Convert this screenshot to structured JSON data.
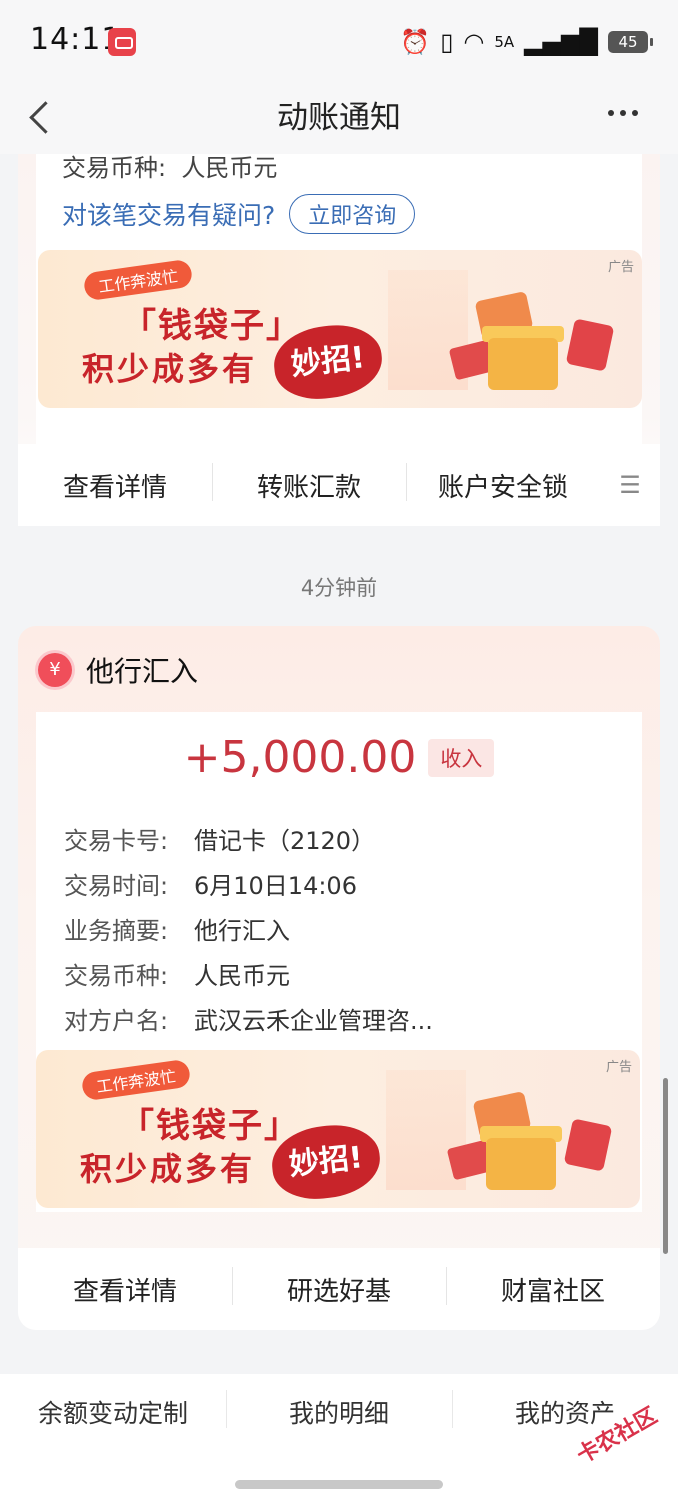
{
  "status_bar": {
    "time": "14:11",
    "network": "5A",
    "battery": "45"
  },
  "header": {
    "title": "动账通知"
  },
  "card1": {
    "cut_row": {
      "key": "交易币种:",
      "value": "人民币元"
    },
    "query_text": "对该笔交易有疑问?",
    "consult_label": "立即咨询",
    "banner": {
      "tag": "工作奔波忙",
      "line1": "「钱袋子」",
      "line2": "积少成多有",
      "badge": "妙招!",
      "ad": "广告"
    },
    "actions": [
      "查看详情",
      "转账汇款",
      "账户安全锁"
    ]
  },
  "time_ago": "4分钟前",
  "card2": {
    "title": "他行汇入",
    "amount": "+5,000.00",
    "amount_tag": "收入",
    "details": [
      {
        "key": "交易卡号:",
        "value": "借记卡（2120）"
      },
      {
        "key": "交易时间:",
        "value": "6月10日14:06"
      },
      {
        "key": "业务摘要:",
        "value": "他行汇入"
      },
      {
        "key": "交易币种:",
        "value": "人民币元"
      },
      {
        "key": "对方户名:",
        "value": "武汉云禾企业管理咨..."
      }
    ],
    "banner": {
      "tag": "工作奔波忙",
      "line1": "「钱袋子」",
      "line2": "积少成多有",
      "badge": "妙招!",
      "ad": "广告"
    },
    "actions": [
      "查看详情",
      "研选好基",
      "财富社区"
    ]
  },
  "bottom_nav": [
    "余额变动定制",
    "我的明细",
    "我的资产"
  ],
  "watermark": "卡农社区"
}
